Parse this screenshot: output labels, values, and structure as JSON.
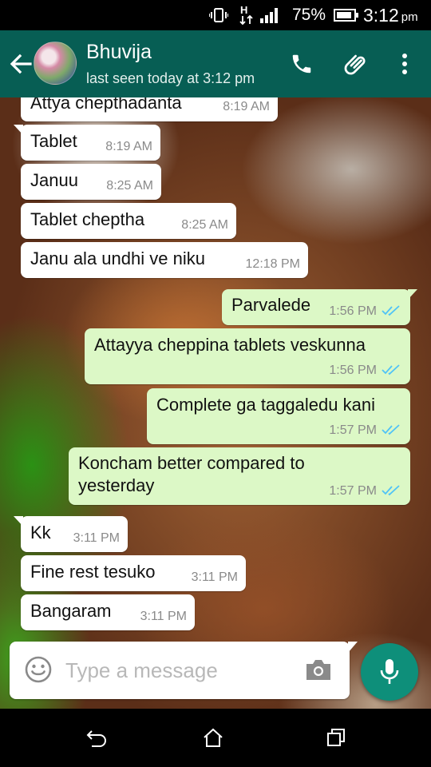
{
  "status_bar": {
    "icons": [
      "vibrate-icon",
      "data-hplus-icon",
      "signal-icon",
      "battery-icon"
    ],
    "data_type": "H",
    "battery_percent": "75%",
    "time": "3:12",
    "time_suffix": "pm"
  },
  "header": {
    "contact_name": "Bhuvija",
    "last_seen": "last seen today at 3:12 pm",
    "icons": [
      "back-arrow-icon",
      "avatar",
      "phone-icon",
      "paperclip-icon",
      "more-vert-icon"
    ]
  },
  "messages": [
    {
      "dir": "in",
      "text": "Attya chepthadanta",
      "time": "8:19 AM"
    },
    {
      "dir": "in",
      "text": "Tablet",
      "time": "8:19 AM"
    },
    {
      "dir": "in",
      "text": "Januu",
      "time": "8:25 AM"
    },
    {
      "dir": "in",
      "text": "Tablet cheptha",
      "time": "8:25 AM"
    },
    {
      "dir": "in",
      "text": "Janu ala undhi ve niku",
      "time": "12:18 PM"
    },
    {
      "dir": "out",
      "text": "Parvalede",
      "time": "1:56 PM",
      "status": "read"
    },
    {
      "dir": "out",
      "text": "Attayya cheppina tablets veskunna",
      "time": "1:56 PM",
      "status": "read"
    },
    {
      "dir": "out",
      "text": "Complete ga taggaledu kani",
      "time": "1:57 PM",
      "status": "read"
    },
    {
      "dir": "out",
      "text": "Koncham better compared to",
      "text2": "yesterday",
      "time": "1:57 PM",
      "status": "read"
    },
    {
      "dir": "in",
      "text": "Kk",
      "time": "3:11 PM"
    },
    {
      "dir": "in",
      "text": "Fine rest tesuko",
      "time": "3:11 PM"
    },
    {
      "dir": "in",
      "text": "Bangaram",
      "time": "3:11 PM"
    }
  ],
  "composer": {
    "placeholder": "Type a message",
    "value": "",
    "icons": [
      "emoji-icon",
      "camera-icon",
      "mic-icon"
    ]
  },
  "nav_bar": {
    "icons": [
      "nav-back-icon",
      "nav-home-icon",
      "nav-recents-icon"
    ]
  },
  "colors": {
    "app_bar": "#075e54",
    "incoming_bubble": "#ffffff",
    "outgoing_bubble": "#dcf8c6",
    "read_ticks": "#4fc3f7",
    "mic_button": "#0e8f7a"
  }
}
